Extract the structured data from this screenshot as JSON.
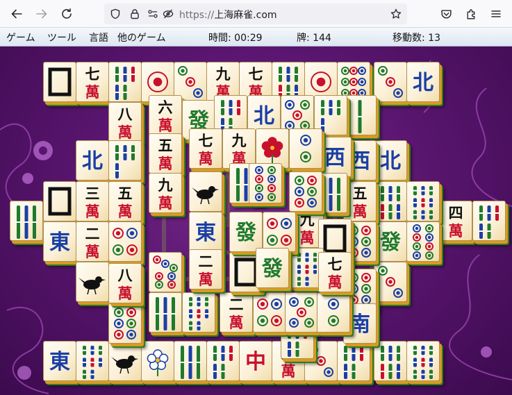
{
  "browser": {
    "url_protocol": "https://",
    "url_host": "上海麻雀.com"
  },
  "menu": {
    "items": [
      "ゲーム",
      "ツール",
      "言語",
      "他のゲーム"
    ],
    "time_label": "時間: 00:29",
    "tiles_label": "牌: 144",
    "moves_label": "移動数: 13"
  },
  "colors": {
    "board_background": "#5a1670",
    "tile_face": "#fbf0d6",
    "tile_side_orange": "#d89a24",
    "tile_side_green": "#2f7d1d",
    "char_red": "#c8102e",
    "wind_blue": "#1a3fa6"
  },
  "tiles": [
    {
      "kind": "dragon",
      "val": "white"
    },
    {
      "kind": "wan",
      "val": "七"
    },
    {
      "kind": "bam",
      "val": "5"
    },
    {
      "kind": "dot",
      "val": "1"
    },
    {
      "kind": "dot",
      "val": "3"
    },
    {
      "kind": "wan",
      "val": "九"
    },
    {
      "kind": "wan",
      "val": "七"
    },
    {
      "kind": "bam",
      "val": "6"
    },
    {
      "kind": "dot",
      "val": "1"
    },
    {
      "kind": "dot",
      "val": "9"
    },
    {
      "kind": "dot",
      "val": "3"
    },
    {
      "kind": "wind",
      "val": "北"
    },
    {
      "kind": "wan",
      "val": "六"
    },
    {
      "kind": "dragon",
      "val": "發"
    },
    {
      "kind": "bam",
      "val": "5"
    },
    {
      "kind": "wind",
      "val": "北"
    },
    {
      "kind": "dot",
      "val": "5"
    },
    {
      "kind": "bam",
      "val": "4"
    },
    {
      "kind": "bam",
      "val": "1"
    },
    {
      "kind": "wan",
      "val": "八"
    },
    {
      "kind": "wan",
      "val": "七"
    },
    {
      "kind": "wan",
      "val": "九"
    },
    {
      "kind": "flower",
      "val": "hibiscus"
    },
    {
      "kind": "dot",
      "val": "2"
    },
    {
      "kind": "wind",
      "val": "西"
    },
    {
      "kind": "wind",
      "val": "北"
    },
    {
      "kind": "bam",
      "val": "4"
    },
    {
      "kind": "wan",
      "val": "五"
    },
    {
      "kind": "wan",
      "val": "九"
    },
    {
      "kind": "bird",
      "val": "1"
    },
    {
      "kind": "bam",
      "val": "3"
    },
    {
      "kind": "dot",
      "val": "8"
    },
    {
      "kind": "dot",
      "val": "6"
    },
    {
      "kind": "bam",
      "val": "3"
    },
    {
      "kind": "wind",
      "val": "西"
    },
    {
      "kind": "wind",
      "val": "北"
    },
    {
      "kind": "dragon",
      "val": "white"
    },
    {
      "kind": "wan",
      "val": "三"
    },
    {
      "kind": "wan",
      "val": "五"
    },
    {
      "kind": "wan",
      "val": "五"
    },
    {
      "kind": "bam",
      "val": "6"
    },
    {
      "kind": "bam",
      "val": "9"
    },
    {
      "kind": "bam",
      "val": "3"
    },
    {
      "kind": "wan",
      "val": "四"
    },
    {
      "kind": "bam",
      "val": "5"
    },
    {
      "kind": "wind",
      "val": "東"
    },
    {
      "kind": "wan",
      "val": "二"
    },
    {
      "kind": "dot",
      "val": "4"
    },
    {
      "kind": "wind",
      "val": "東"
    },
    {
      "kind": "dragon",
      "val": "發"
    },
    {
      "kind": "dot",
      "val": "4"
    },
    {
      "kind": "wan",
      "val": "九"
    },
    {
      "kind": "dragon",
      "val": "white"
    },
    {
      "kind": "dot",
      "val": "6"
    },
    {
      "kind": "dragon",
      "val": "發"
    },
    {
      "kind": "dot",
      "val": "8"
    },
    {
      "kind": "dot",
      "val": "1"
    },
    {
      "kind": "bird",
      "val": "1"
    },
    {
      "kind": "wan",
      "val": "八"
    },
    {
      "kind": "dot",
      "val": "7"
    },
    {
      "kind": "wan",
      "val": "二"
    },
    {
      "kind": "dragon",
      "val": "white"
    },
    {
      "kind": "dragon",
      "val": "發"
    },
    {
      "kind": "bam",
      "val": "8"
    },
    {
      "kind": "wan",
      "val": "七"
    },
    {
      "kind": "dot",
      "val": "6"
    },
    {
      "kind": "dot",
      "val": "3"
    },
    {
      "kind": "dot",
      "val": "6"
    },
    {
      "kind": "bam",
      "val": "3"
    },
    {
      "kind": "bam",
      "val": "8"
    },
    {
      "kind": "wan",
      "val": "二"
    },
    {
      "kind": "dot",
      "val": "4"
    },
    {
      "kind": "dot",
      "val": "5"
    },
    {
      "kind": "dot",
      "val": "2"
    },
    {
      "kind": "bam",
      "val": "5"
    },
    {
      "kind": "wind",
      "val": "南"
    },
    {
      "kind": "wind",
      "val": "東"
    },
    {
      "kind": "bam",
      "val": "8"
    },
    {
      "kind": "bird",
      "val": "1"
    },
    {
      "kind": "flower",
      "val": "plum"
    },
    {
      "kind": "bam",
      "val": "3"
    },
    {
      "kind": "bam",
      "val": "5"
    },
    {
      "kind": "dragon",
      "val": "中"
    },
    {
      "kind": "wan",
      "val": "六"
    },
    {
      "kind": "dot",
      "val": "3"
    },
    {
      "kind": "bam",
      "val": "5"
    },
    {
      "kind": "bam",
      "val": "6"
    },
    {
      "kind": "bam",
      "val": "9"
    }
  ]
}
